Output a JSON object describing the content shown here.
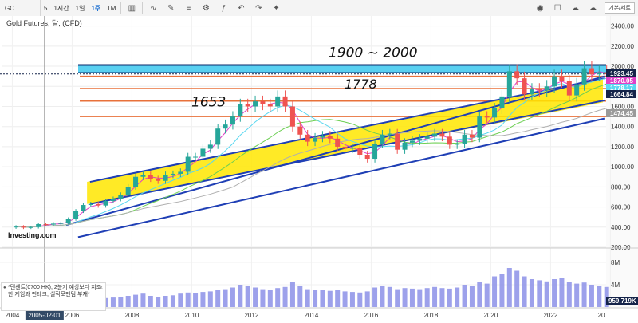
{
  "toolbar": {
    "symbol": "GC",
    "intervals": [
      "5",
      "1시간",
      "1일",
      "1주",
      "1M"
    ],
    "active_interval": "1주",
    "chart_type_icon": "candlestick-icon",
    "tool_icons": [
      "indicator-icon",
      "drawing-icon",
      "text-icon",
      "settings-icon",
      "fx-icon",
      "undo-icon",
      "redo-icon",
      "star-icon"
    ],
    "right_icons": [
      "camera-icon",
      "checkbox-icon",
      "cloud-icon",
      "cloud-save-icon"
    ],
    "default_button": "기본/세트"
  },
  "chart_title": "Gold Futures, 달, (CFD)",
  "logo": "Investing.com",
  "news": {
    "text": "*텐센트(0700 HK), 2분기 예상보다 저조한 게임과 핀테크, 실적모멘텀 부재*"
  },
  "annotations": {
    "top_range": "1900 ~ 2000",
    "left_level": "1653",
    "mid_level": "1778"
  },
  "colors": {
    "up": "#26a69a",
    "down": "#ef5350",
    "channel": "#1f3fb5",
    "support": "#e8713a",
    "band_yellow": "#ffe600",
    "band_cyan": "#3cc8ee",
    "ma_pink": "#e040c8",
    "ma_cyan": "#5ad7f0",
    "ma_green": "#6ccf52",
    "ma_grey": "#b0b0b0"
  },
  "chart_data": {
    "type": "candlestick",
    "x_ticks": [
      "2004",
      "2005-02-01",
      "2006",
      "2008",
      "2010",
      "2012",
      "2014",
      "2016",
      "2018",
      "2020",
      "2022",
      "20"
    ],
    "y_axis": {
      "ylim": [
        200,
        2500
      ],
      "ticks": [
        "2400.00",
        "2200.00",
        "2000.00",
        "1800.00",
        "1600.00",
        "1400.00",
        "1200.00",
        "1000.00",
        "800.00",
        "600.00",
        "400.00",
        "200.00"
      ]
    },
    "price_labels": [
      {
        "text": "1923.45",
        "value": 1923.45,
        "color": "#15244a"
      },
      {
        "text": "1870.05",
        "value": 1870.05,
        "color": "#e040c8"
      },
      {
        "text": "1778.17",
        "value": 1778.17,
        "color": "#5ad7f0"
      },
      {
        "text": "1664.84",
        "value": 1664.84,
        "color": "#15244a"
      },
      {
        "text": "1474.45",
        "value": 1474.45,
        "color": "#9a9a9a"
      }
    ],
    "horizontal_levels": [
      {
        "value": 2000,
        "kind": "resistance-top"
      },
      {
        "value": 1923.45,
        "kind": "dotted"
      },
      {
        "value": 1900,
        "kind": "orange"
      },
      {
        "value": 1778,
        "kind": "orange"
      },
      {
        "value": 1653,
        "kind": "orange"
      },
      {
        "value": 1500,
        "kind": "orange"
      }
    ],
    "series": {
      "dates": [
        2004.0,
        2004.25,
        2004.5,
        2004.75,
        2005.0,
        2005.25,
        2005.5,
        2005.75,
        2006.0,
        2006.25,
        2006.5,
        2006.75,
        2007.0,
        2007.25,
        2007.5,
        2007.75,
        2008.0,
        2008.25,
        2008.5,
        2008.75,
        2009.0,
        2009.25,
        2009.5,
        2009.75,
        2010.0,
        2010.25,
        2010.5,
        2010.75,
        2011.0,
        2011.25,
        2011.5,
        2011.75,
        2012.0,
        2012.25,
        2012.5,
        2012.75,
        2013.0,
        2013.25,
        2013.5,
        2013.75,
        2014.0,
        2014.25,
        2014.5,
        2014.75,
        2015.0,
        2015.25,
        2015.5,
        2015.75,
        2016.0,
        2016.25,
        2016.5,
        2016.75,
        2017.0,
        2017.25,
        2017.5,
        2017.75,
        2018.0,
        2018.25,
        2018.5,
        2018.75,
        2019.0,
        2019.25,
        2019.5,
        2019.75,
        2020.0,
        2020.25,
        2020.5,
        2020.75,
        2021.0,
        2021.25,
        2021.5,
        2021.75,
        2022.0,
        2022.25,
        2022.5,
        2022.75,
        2023.0,
        2023.25,
        2023.5,
        2023.75
      ],
      "close": [
        405,
        395,
        400,
        430,
        425,
        435,
        440,
        480,
        560,
        620,
        630,
        615,
        660,
        680,
        720,
        800,
        900,
        920,
        880,
        860,
        920,
        930,
        950,
        1100,
        1100,
        1180,
        1220,
        1380,
        1420,
        1500,
        1620,
        1600,
        1650,
        1620,
        1600,
        1700,
        1600,
        1400,
        1320,
        1250,
        1290,
        1310,
        1280,
        1200,
        1180,
        1190,
        1120,
        1080,
        1230,
        1320,
        1330,
        1170,
        1240,
        1260,
        1280,
        1300,
        1330,
        1300,
        1220,
        1230,
        1320,
        1290,
        1500,
        1490,
        1580,
        1700,
        1950,
        1880,
        1720,
        1770,
        1760,
        1800,
        1900,
        1850,
        1710,
        1820,
        1980,
        1920,
        1940,
        1920
      ],
      "volume_millions": [
        1.0,
        1.1,
        1.0,
        1.2,
        1.2,
        1.3,
        1.2,
        1.4,
        1.5,
        1.6,
        1.5,
        1.4,
        1.6,
        1.7,
        1.8,
        2.0,
        2.2,
        2.4,
        2.0,
        1.8,
        2.0,
        2.1,
        2.4,
        2.6,
        2.5,
        2.7,
        2.8,
        3.0,
        3.2,
        3.5,
        4.0,
        3.8,
        3.5,
        3.2,
        3.0,
        3.4,
        3.6,
        4.5,
        3.8,
        3.2,
        3.0,
        3.1,
        2.9,
        3.0,
        2.8,
        2.7,
        2.6,
        2.8,
        3.5,
        3.8,
        3.6,
        3.2,
        3.4,
        3.3,
        3.2,
        3.4,
        3.6,
        3.4,
        3.3,
        3.5,
        4.0,
        3.8,
        4.5,
        4.2,
        5.5,
        6.0,
        7.0,
        6.5,
        5.5,
        5.0,
        4.8,
        4.6,
        5.0,
        5.2,
        4.5,
        4.2,
        4.4,
        4.0,
        3.8,
        3.6
      ]
    },
    "volume_axis": {
      "ticks": [
        "8M",
        "4M"
      ],
      "current": "959.719K"
    }
  }
}
